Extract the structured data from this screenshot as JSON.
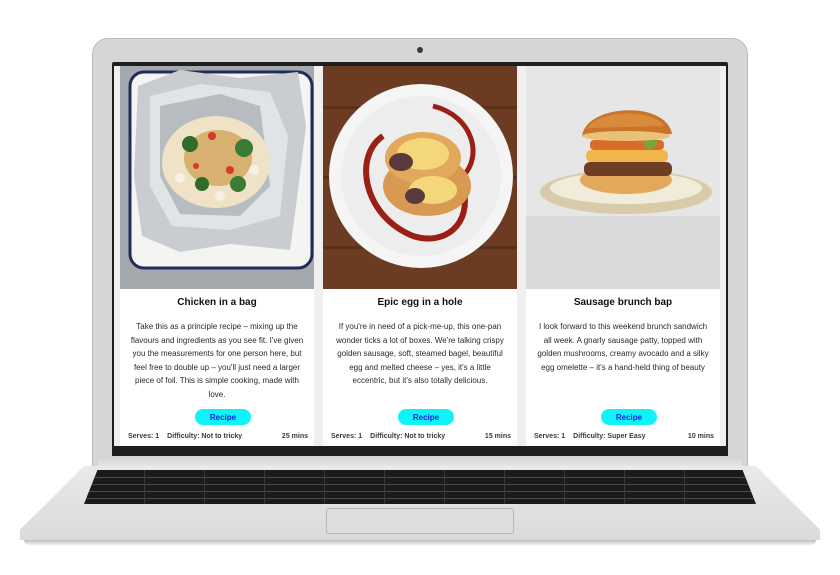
{
  "recipes": [
    {
      "title": "Chicken in a bag",
      "description": "Take this as a principle recipe – mixing up the flavours and ingredients as you see fit. I've given you the measurements for one person here, but feel free to double up – you'll just need a larger piece of foil. This is simple cooking, made with love.",
      "button_label": "Recipe",
      "serves": "Serves: 1",
      "difficulty": "Difficulty: Not to tricky",
      "time": "25 mins"
    },
    {
      "title": "Epic egg in a hole",
      "description": "If you're in need of a pick-me-up, this one-pan wonder ticks a lot of boxes. We're talking crispy golden sausage, soft, steamed bagel, beautiful egg and melted cheese – yes, it's a little eccentric, but it's also totally delicious.",
      "button_label": "Recipe",
      "serves": "Serves: 1",
      "difficulty": "Difficulty: Not to tricky",
      "time": "15 mins"
    },
    {
      "title": "Sausage brunch bap",
      "description": "I look forward to this weekend brunch sandwich all week. A gnarly sausage patty, topped with golden mushrooms, creamy avocado and a silky egg omelette – it's a hand-held thing of beauty",
      "button_label": "Recipe",
      "serves": "Serves: 1",
      "difficulty": "Difficulty: Super Easy",
      "time": "10 mins"
    }
  ],
  "colors": {
    "button_bg": "#10f2f8",
    "button_text": "#0b2bd6"
  }
}
